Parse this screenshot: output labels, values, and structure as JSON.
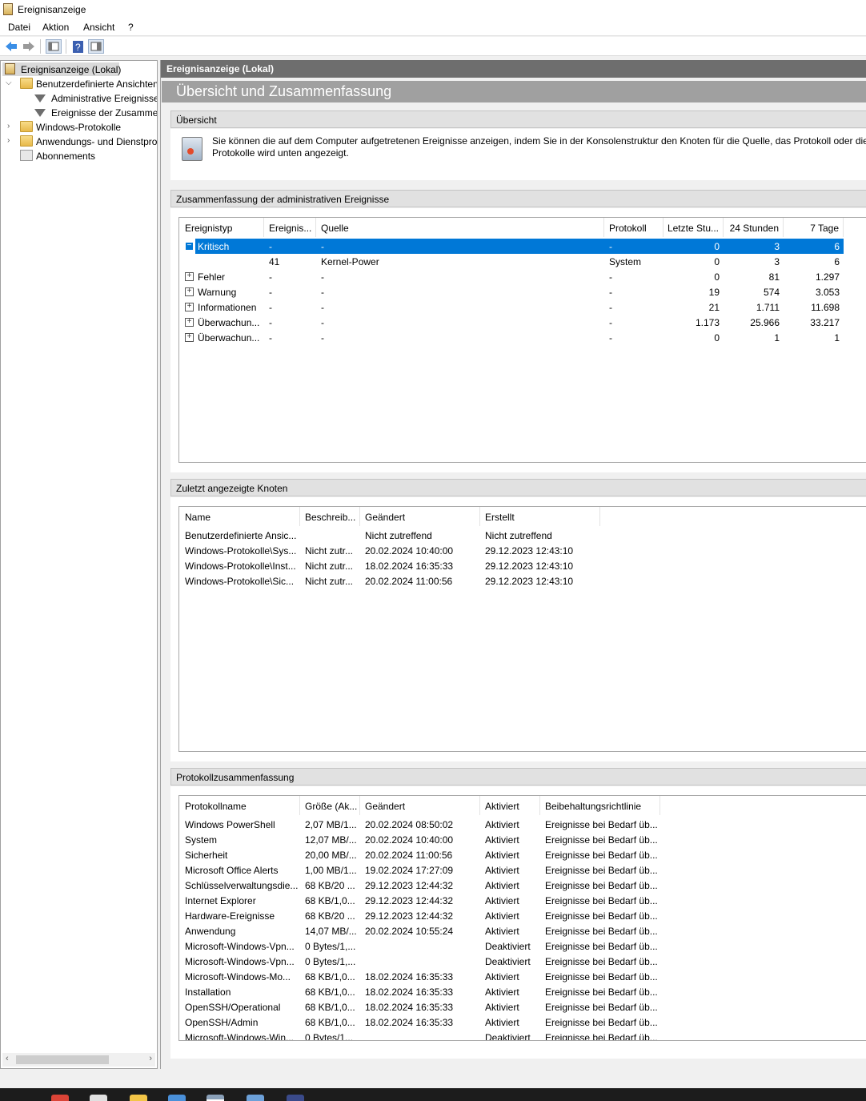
{
  "window": {
    "title": "Ereignisanzeige"
  },
  "menu": [
    "Datei",
    "Aktion",
    "Ansicht",
    "?"
  ],
  "toolbar": [
    {
      "icon": "back-arrow-icon"
    },
    {
      "icon": "forward-arrow-icon"
    },
    {
      "icon": "show-hide-console-tree-icon"
    },
    {
      "icon": "help-icon"
    },
    {
      "icon": "show-hide-action-pane-icon"
    }
  ],
  "tree": {
    "root": "Ereignisanzeige (Lokal)",
    "custom_views": "Benutzerdefinierte Ansichten",
    "admin_events": "Administrative Ereignisse",
    "summary_events": "Ereignisse der Zusammenfassung",
    "windows_logs": "Windows-Protokolle",
    "app_logs": "Anwendungs- und Dienstprotokolle",
    "subscriptions": "Abonnements"
  },
  "right": {
    "header": "Ereignisanzeige (Lokal)",
    "banner": "Übersicht und Zusammenfassung",
    "overview": {
      "title": "Übersicht",
      "line1": "Sie können die auf dem Computer aufgetretenen Ereignisse anzeigen, indem Sie in der Konsolenstruktur den Knoten für die Quelle, das Protokoll oder die b",
      "line2": "Protokolle wird unten angezeigt."
    },
    "admin_summary": {
      "title": "Zusammenfassung der administrativen Ereignisse",
      "columns": [
        "Ereignistyp",
        "Ereignis...",
        "Quelle",
        "Protokoll",
        "Letzte Stu...",
        "24 Stunden",
        "7 Tage"
      ],
      "rows": [
        {
          "type": "Kritisch",
          "id": "-",
          "source": "-",
          "log": "-",
          "hour": "0",
          "day": "3",
          "week": "6",
          "expander": "−",
          "selected": true
        },
        {
          "type": "",
          "id": "41",
          "source": "Kernel-Power",
          "log": "System",
          "hour": "0",
          "day": "3",
          "week": "6",
          "expander": "",
          "selected": false
        },
        {
          "type": "Fehler",
          "id": "-",
          "source": "-",
          "log": "-",
          "hour": "0",
          "day": "81",
          "week": "1.297",
          "expander": "+",
          "selected": false
        },
        {
          "type": "Warnung",
          "id": "-",
          "source": "-",
          "log": "-",
          "hour": "19",
          "day": "574",
          "week": "3.053",
          "expander": "+",
          "selected": false
        },
        {
          "type": "Informationen",
          "id": "-",
          "source": "-",
          "log": "-",
          "hour": "21",
          "day": "1.711",
          "week": "11.698",
          "expander": "+",
          "selected": false
        },
        {
          "type": "Überwachun...",
          "id": "-",
          "source": "-",
          "log": "-",
          "hour": "1.173",
          "day": "25.966",
          "week": "33.217",
          "expander": "+",
          "selected": false
        },
        {
          "type": "Überwachun...",
          "id": "-",
          "source": "-",
          "log": "-",
          "hour": "0",
          "day": "1",
          "week": "1",
          "expander": "+",
          "selected": false
        }
      ]
    },
    "recent_nodes": {
      "title": "Zuletzt angezeigte Knoten",
      "columns": [
        "Name",
        "Beschreib...",
        "Geändert",
        "Erstellt"
      ],
      "rows": [
        [
          "Benutzerdefinierte Ansic...",
          "",
          "Nicht zutreffend",
          "Nicht zutreffend"
        ],
        [
          "Windows-Protokolle\\Sys...",
          "Nicht zutr...",
          "20.02.2024 10:40:00",
          "29.12.2023 12:43:10"
        ],
        [
          "Windows-Protokolle\\Inst...",
          "Nicht zutr...",
          "18.02.2024 16:35:33",
          "29.12.2023 12:43:10"
        ],
        [
          "Windows-Protokolle\\Sic...",
          "Nicht zutr...",
          "20.02.2024 11:00:56",
          "29.12.2023 12:43:10"
        ]
      ]
    },
    "log_summary": {
      "title": "Protokollzusammenfassung",
      "columns": [
        "Protokollname",
        "Größe (Ak...",
        "Geändert",
        "Aktiviert",
        "Beibehaltungsrichtlinie"
      ],
      "rows": [
        [
          "Windows PowerShell",
          "2,07 MB/1...",
          "20.02.2024 08:50:02",
          "Aktiviert",
          "Ereignisse bei Bedarf üb..."
        ],
        [
          "System",
          "12,07 MB/...",
          "20.02.2024 10:40:00",
          "Aktiviert",
          "Ereignisse bei Bedarf üb..."
        ],
        [
          "Sicherheit",
          "20,00 MB/...",
          "20.02.2024 11:00:56",
          "Aktiviert",
          "Ereignisse bei Bedarf üb..."
        ],
        [
          "Microsoft Office Alerts",
          "1,00 MB/1...",
          "19.02.2024 17:27:09",
          "Aktiviert",
          "Ereignisse bei Bedarf üb..."
        ],
        [
          "Schlüsselverwaltungsdie...",
          "68 KB/20 ...",
          "29.12.2023 12:44:32",
          "Aktiviert",
          "Ereignisse bei Bedarf üb..."
        ],
        [
          "Internet Explorer",
          "68 KB/1,0...",
          "29.12.2023 12:44:32",
          "Aktiviert",
          "Ereignisse bei Bedarf üb..."
        ],
        [
          "Hardware-Ereignisse",
          "68 KB/20 ...",
          "29.12.2023 12:44:32",
          "Aktiviert",
          "Ereignisse bei Bedarf üb..."
        ],
        [
          "Anwendung",
          "14,07 MB/...",
          "20.02.2024 10:55:24",
          "Aktiviert",
          "Ereignisse bei Bedarf üb..."
        ],
        [
          "Microsoft-Windows-Vpn...",
          "0 Bytes/1,...",
          "",
          "Deaktiviert",
          "Ereignisse bei Bedarf üb..."
        ],
        [
          "Microsoft-Windows-Vpn...",
          "0 Bytes/1,...",
          "",
          "Deaktiviert",
          "Ereignisse bei Bedarf üb..."
        ],
        [
          "Microsoft-Windows-Mo...",
          "68 KB/1,0...",
          "18.02.2024 16:35:33",
          "Aktiviert",
          "Ereignisse bei Bedarf üb..."
        ],
        [
          "Installation",
          "68 KB/1,0...",
          "18.02.2024 16:35:33",
          "Aktiviert",
          "Ereignisse bei Bedarf üb..."
        ],
        [
          "OpenSSH/Operational",
          "68 KB/1,0...",
          "18.02.2024 16:35:33",
          "Aktiviert",
          "Ereignisse bei Bedarf üb..."
        ],
        [
          "OpenSSH/Admin",
          "68 KB/1,0...",
          "18.02.2024 16:35:33",
          "Aktiviert",
          "Ereignisse bei Bedarf üb..."
        ],
        [
          "Microsoft-Windows-Win...",
          "0 Bytes/1...",
          "",
          "Deaktiviert",
          "Ereignisse bei Bedarf üb..."
        ]
      ]
    }
  },
  "colors": {
    "selection": "#0078d7",
    "header_dark": "#6e6e6e",
    "banner": "#a0a0a0"
  }
}
